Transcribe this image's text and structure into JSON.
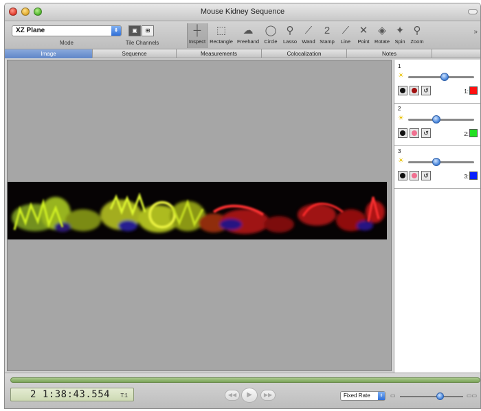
{
  "window": {
    "title": "Mouse Kidney Sequence"
  },
  "toolbar": {
    "mode": {
      "value": "XZ Plane",
      "label": "Mode"
    },
    "tile_channels_label": "Tile Channels",
    "tools": [
      {
        "label": "Inspect",
        "icon": "crosshair-icon",
        "glyph": "┼"
      },
      {
        "label": "Rectangle",
        "icon": "rectangle-select-icon",
        "glyph": "⬚"
      },
      {
        "label": "Freehand",
        "icon": "freehand-icon",
        "glyph": "☁"
      },
      {
        "label": "Circle",
        "icon": "circle-select-icon",
        "glyph": "◯"
      },
      {
        "label": "Lasso",
        "icon": "lasso-icon",
        "glyph": "⚲"
      },
      {
        "label": "Wand",
        "icon": "wand-icon",
        "glyph": "⟋"
      },
      {
        "label": "Stamp",
        "icon": "stamp-icon",
        "glyph": "2"
      },
      {
        "label": "Line",
        "icon": "line-icon",
        "glyph": "⟋"
      },
      {
        "label": "Point",
        "icon": "point-icon",
        "glyph": "✕"
      },
      {
        "label": "Rotate",
        "icon": "rotate-icon",
        "glyph": "◈"
      },
      {
        "label": "Spin",
        "icon": "spin-icon",
        "glyph": "✦"
      },
      {
        "label": "Zoom",
        "icon": "zoom-icon",
        "glyph": "⚲"
      }
    ]
  },
  "tabs": [
    "Image",
    "Sequence",
    "Measurements",
    "Colocalization",
    "Notes"
  ],
  "channels": [
    {
      "number": "1",
      "swatch_label": "1:",
      "color": "#ff1010",
      "level": 0.55
    },
    {
      "number": "2",
      "swatch_label": "2:",
      "color": "#22e022",
      "level": 0.43
    },
    {
      "number": "3",
      "swatch_label": "3:",
      "color": "#0a20ff",
      "level": 0.43
    }
  ],
  "playback": {
    "time": "2 1:38:43.554",
    "timepoint_label": "T:1",
    "rate": "Fixed Rate",
    "speed_level": 0.64
  }
}
